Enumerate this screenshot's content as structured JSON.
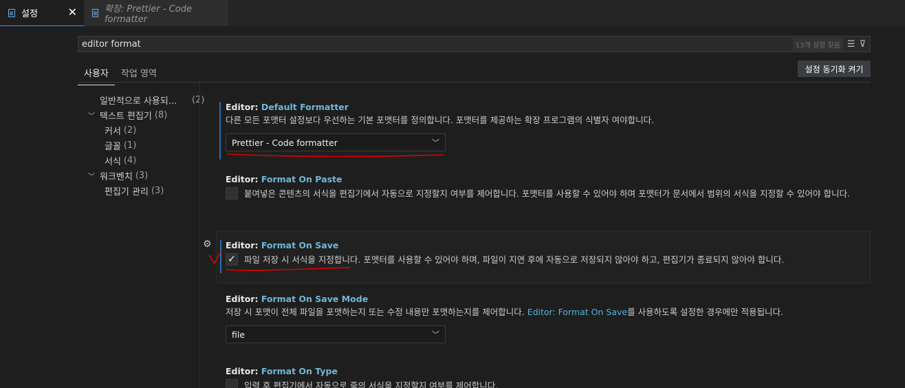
{
  "tabs": [
    {
      "label": "설정"
    },
    {
      "label": "확장: Prettier - Code formatter"
    }
  ],
  "search": {
    "value": "editor format",
    "result_count": "13개 설정 찾음"
  },
  "scope_tabs": [
    {
      "label": "사용자"
    },
    {
      "label": "작업 영역"
    }
  ],
  "sync_button": "설정 동기화 켜기",
  "toc": [
    {
      "label": "일반적으로 사용되...",
      "count": "(2)"
    },
    {
      "label": "텍스트 편집기",
      "count": "(8)"
    },
    {
      "label": "커서",
      "count": "(2)"
    },
    {
      "label": "글꼴",
      "count": "(1)"
    },
    {
      "label": "서식",
      "count": "(4)"
    },
    {
      "label": "워크벤치",
      "count": "(3)"
    },
    {
      "label": "편집기 관리",
      "count": "(3)"
    }
  ],
  "settings": {
    "default_formatter": {
      "category": "Editor: ",
      "name": "Default Formatter",
      "description": "다른 모든 포맷터 설정보다 우선하는 기본 포맷터를 정의합니다. 포맷터를 제공하는 확장 프로그램의 식별자 여야합니다.",
      "value": "Prettier - Code formatter"
    },
    "format_on_paste": {
      "category": "Editor: ",
      "name": "Format On Paste",
      "description": "붙여넣은 콘텐츠의 서식을 편집기에서 자동으로 지정할지 여부를 제어합니다. 포맷터를 사용할 수 있어야 하며 포맷터가 문서에서 범위의 서식을 지정할 수 있어야 합니다.",
      "checked": false
    },
    "format_on_save": {
      "category": "Editor: ",
      "name": "Format On Save",
      "description": "파일 저장 시 서식을 지정합니다. 포맷터를 사용할 수 있어야 하며, 파일이 지연 후에 자동으로 저장되지 않아야 하고, 편집기가 종료되지 않아야 합니다.",
      "checked": true
    },
    "format_on_save_mode": {
      "category": "Editor: ",
      "name": "Format On Save Mode",
      "description_before": "저장 시 포맷이 전체 파일을 포맷하는지 또는 수정 내용만 포맷하는지를 제어합니다. ",
      "description_link": "Editor: Format On Save",
      "description_after": "를 사용하도록 설정한 경우에만 적용됩니다.",
      "value": "file"
    },
    "format_on_type": {
      "category": "Editor: ",
      "name": "Format On Type",
      "description": "입력 후 편집기에서 자동으로 줄의 서식을 지정할지 여부를 제어합니다.",
      "checked": false
    }
  },
  "colors": {
    "accent": "#3794ff",
    "setting_name": "#6fb8d8",
    "annotation": "#e00000"
  },
  "icons": [
    "file-icon",
    "close-icon",
    "clear-filter-icon",
    "filter-icon",
    "chevron-down-icon",
    "gear-icon",
    "check-icon"
  ]
}
